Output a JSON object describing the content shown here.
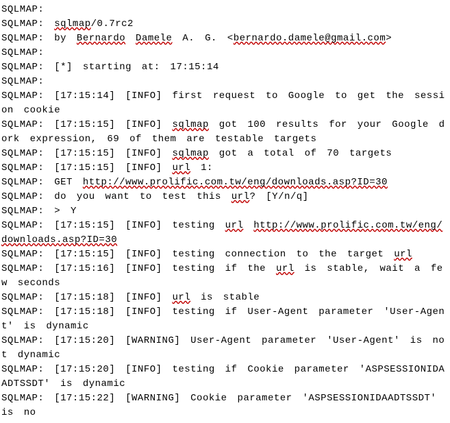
{
  "prefix": "SQLMAP:",
  "sqlmap_word": "sqlmap",
  "url_word": "url",
  "lines": {
    "l1": "",
    "l2_a": "/0.7rc2",
    "l3_a": " by ",
    "l3_b": "Bernardo",
    "l3_c": " ",
    "l3_d": "Damele",
    "l3_e": " A. G.  <",
    "l3_f": "bernardo.damele@gmail.com",
    "l3_g": ">",
    "l5": " [*] starting at: 17:15:14",
    "l7": " [17:15:14] [INFO] first request to Google to get the session cookie",
    "l8_a": " [17:15:15] [INFO] ",
    "l8_b": " got 100 results for your Google dork expression, 69 of them are testable targets",
    "l9_a": " [17:15:15] [INFO] ",
    "l9_b": " got a total of 70 targets",
    "l10_a": " [17:15:15] [INFO] ",
    "l10_b": " 1:",
    "l11_a": " GET ",
    "l11_b": "http://www.prolific.com.tw/eng/downloads.asp?ID=30",
    "l12_a": " do you want to test this ",
    "l12_b": "? [Y/n/q]",
    "l13": " > Y",
    "l14_a": " [17:15:15] [INFO] testing ",
    "l14_b": " ",
    "l14_c": "http://www.prolific.com.tw/eng/downloads.asp?ID=30",
    "l15_a": " [17:15:15] [INFO] testing connection to the target ",
    "l16_a": " [17:15:16] [INFO] testing if the ",
    "l16_b": " is stable, wait a few seconds",
    "l17_a": " [17:15:18] [INFO] ",
    "l17_b": " is stable",
    "l18": " [17:15:18] [INFO] testing if User-Agent parameter 'User-Agent' is dynamic",
    "l19": " [17:15:20] [WARNING] User-Agent parameter 'User-Agent' is not dynamic",
    "l20": " [17:15:20] [INFO] testing if Cookie parameter 'ASPSESSIONIDAADTSSDT' is dynamic",
    "l21": " [17:15:22] [WARNING] Cookie parameter 'ASPSESSIONIDAADTSSDT' is no"
  }
}
